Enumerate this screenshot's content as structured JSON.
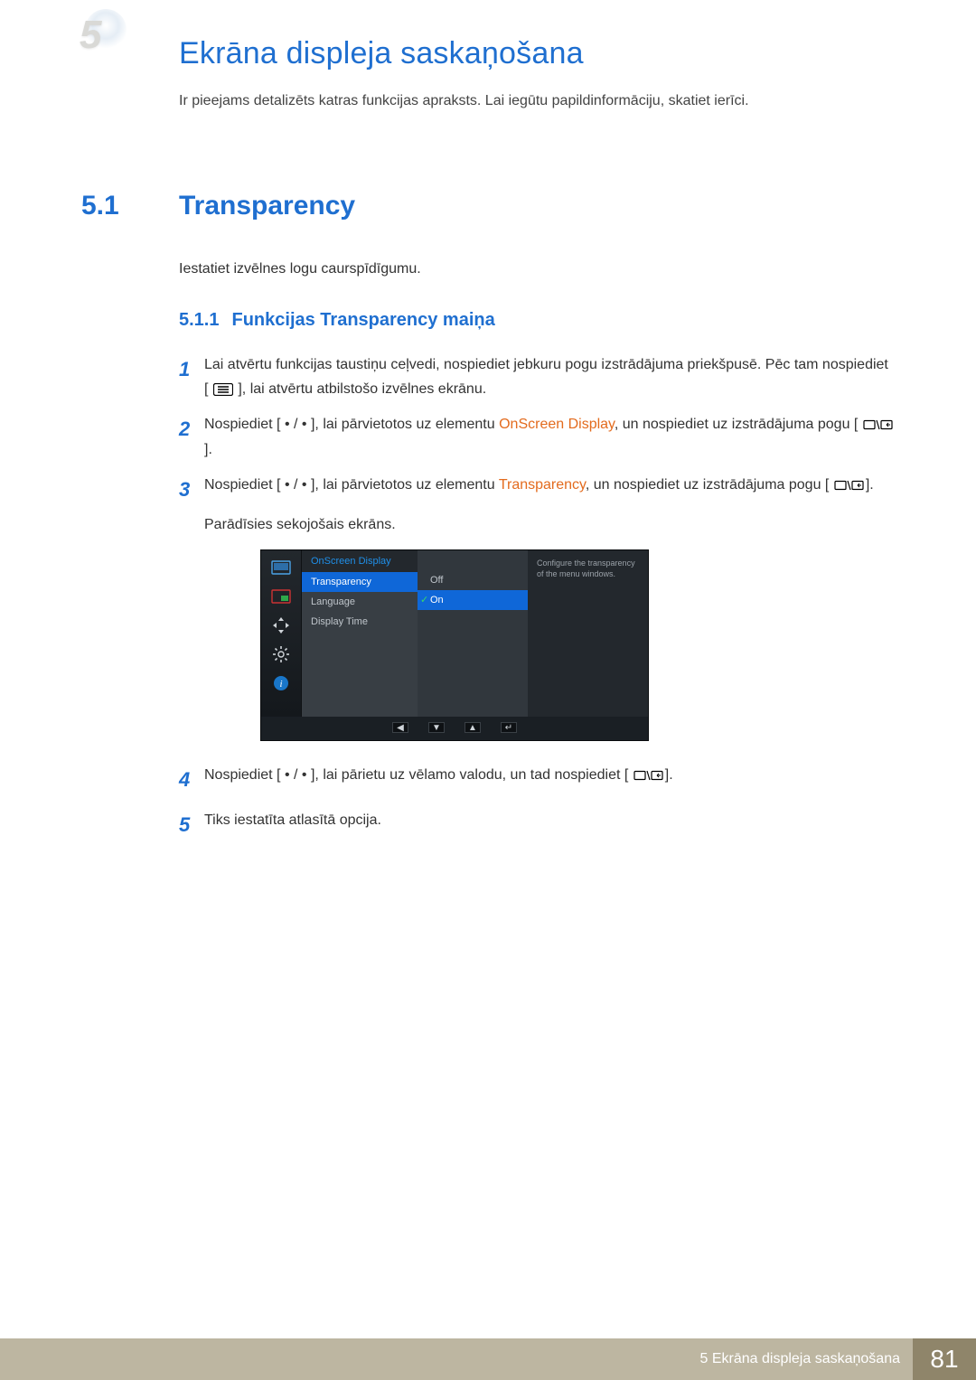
{
  "chapter": {
    "number": "5",
    "title": "Ekrāna displeja saskaņošana",
    "intro": "Ir pieejams detalizēts katras funkcijas apraksts. Lai iegūtu papildinformāciju, skatiet ierīci."
  },
  "section": {
    "number": "5.1",
    "title": "Transparency",
    "intro": "Iestatiet izvēlnes logu caurspīdīgumu."
  },
  "subsection": {
    "number": "5.1.1",
    "title": "Funkcijas Transparency maiņa"
  },
  "steps": {
    "s1": {
      "num": "1",
      "text_a": "Lai atvērtu funkcijas taustiņu ceļvedi, nospiediet jebkuru pogu izstrādājuma priekšpusē. Pēc tam nospiediet [",
      "text_b": "], lai atvērtu atbilstošo izvēlnes ekrānu."
    },
    "s2": {
      "num": "2",
      "text_a": "Nospiediet [",
      "dot": "•",
      "slash": "/",
      "text_b": "], lai pārvietotos uz elementu ",
      "hl": "OnScreen Display",
      "text_c": ", un nospiediet uz izstrādājuma pogu [",
      "text_d": "]."
    },
    "s3": {
      "num": "3",
      "text_a": "Nospiediet [",
      "dot": "•",
      "slash": "/",
      "text_b": "], lai pārvietotos uz elementu ",
      "hl": "Transparency",
      "text_c": ", un nospiediet uz izstrādājuma pogu [",
      "text_d": "]."
    },
    "note_after_3": "Parādīsies sekojošais ekrāns.",
    "s4": {
      "num": "4",
      "text_a": "Nospiediet [",
      "dot": "•",
      "slash": "/",
      "text_b": "], lai pārietu uz vēlamo valodu, un tad nospiediet [",
      "text_c": "]."
    },
    "s5": {
      "num": "5",
      "text": "Tiks iestatīta atlasītā opcija."
    }
  },
  "osd": {
    "header": "OnScreen Display",
    "menu": [
      "Transparency",
      "Language",
      "Display Time"
    ],
    "options": [
      "Off",
      "On"
    ],
    "help": "Configure the transparency of the menu windows."
  },
  "footer": {
    "text": "5 Ekrāna displeja saskaņošana",
    "page": "81"
  }
}
